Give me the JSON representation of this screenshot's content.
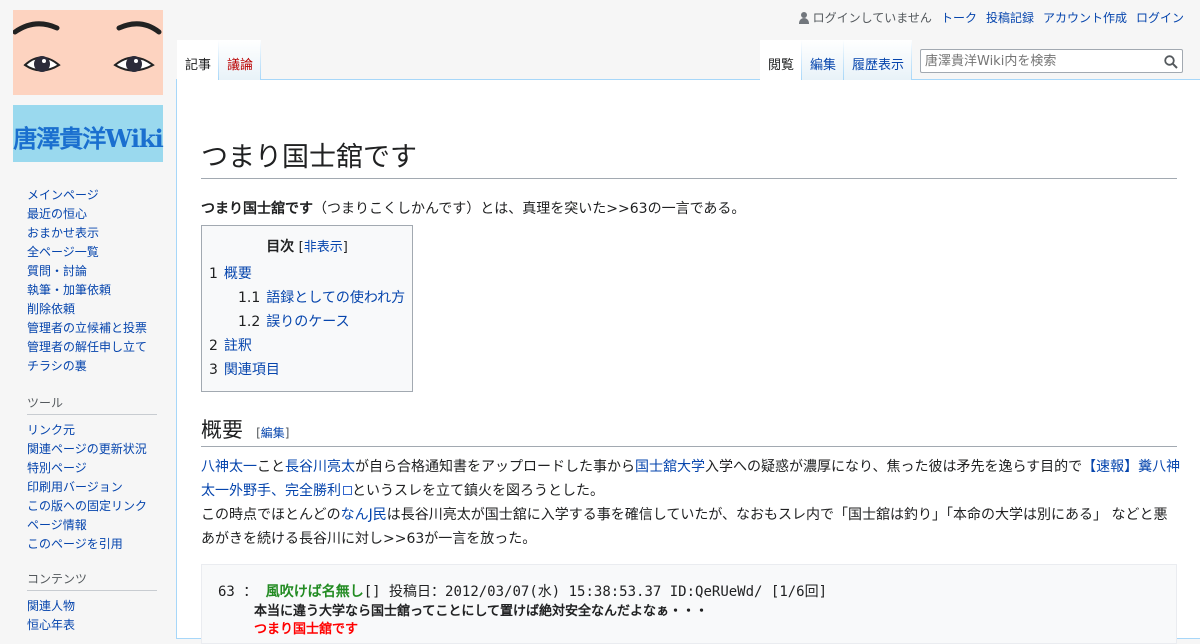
{
  "logo": {
    "text": "唐澤貴洋Wiki"
  },
  "personal": {
    "status": "ログインしていません",
    "links": [
      "トーク",
      "投稿記録",
      "アカウント作成",
      "ログイン"
    ]
  },
  "tabs": {
    "left": [
      "記事",
      "議論"
    ],
    "right": [
      "閲覧",
      "編集",
      "履歴表示"
    ]
  },
  "search": {
    "placeholder": "唐澤貴洋Wiki内を検索"
  },
  "sidebar": {
    "navigation": [
      "メインページ",
      "最近の恒心",
      "おまかせ表示",
      "全ページ一覧",
      "質問・討論",
      "執筆・加筆依頼",
      "削除依頼",
      "管理者の立候補と投票",
      "管理者の解任申し立て",
      "チラシの裏"
    ],
    "tools_heading": "ツール",
    "tools": [
      "リンク元",
      "関連ページの更新状況",
      "特別ページ",
      "印刷用バージョン",
      "この版への固定リンク",
      "ページ情報",
      "このページを引用"
    ],
    "contents_heading": "コンテンツ",
    "contents": [
      "関連人物",
      "恒心年表"
    ]
  },
  "article": {
    "title": "つまり国士舘です",
    "lead_bold": "つまり国士舘です",
    "lead_rest": "（つまりこくしかんです）とは、真理を突いた>>63の一言である。",
    "toc": {
      "title": "目次",
      "toggle": "非表示",
      "items": [
        {
          "num": "1",
          "label": "概要"
        },
        {
          "num": "1.1",
          "label": "語録としての使われ方"
        },
        {
          "num": "1.2",
          "label": "誤りのケース"
        },
        {
          "num": "2",
          "label": "註釈"
        },
        {
          "num": "3",
          "label": "関連項目"
        }
      ]
    },
    "section_title": "概要",
    "section_edit": "編集",
    "para1": {
      "link1": "八神太一",
      "t1": "こと",
      "link2": "長谷川亮太",
      "t2": "が自ら合格通知書をアップロードした事から",
      "link3": "国士舘大学",
      "t3": "入学への疑惑が濃厚になり、焦った彼は矛先を逸らす目的で",
      "link4": "【速報】糞八神太一外野手、完全勝利",
      "t4": "というスレを立て鎮火を図ろうとした。"
    },
    "para2": {
      "t1": "この時点でほとんどの",
      "link1": "なんJ民",
      "t2": "は長谷川亮太が国士舘に入学する事を確信していたが、なおもスレ内で「国士舘は釣り」「本命の大学は別にある」 などと悪あがきを続ける長谷川に対し>>63が一言を放った。"
    },
    "quote": {
      "num": "63",
      "sep": "：",
      "name": "風吹けば名無し",
      "mail": "[]",
      "meta": "投稿日：2012/03/07(水) 15:38:53.37 ID:QeRUeWd/ [1/6回]",
      "line2": "本当に違う大学なら国士舘ってことにして置けば絶対安全なんだよなぁ・・・",
      "line3": "つまり国士舘です"
    }
  }
}
